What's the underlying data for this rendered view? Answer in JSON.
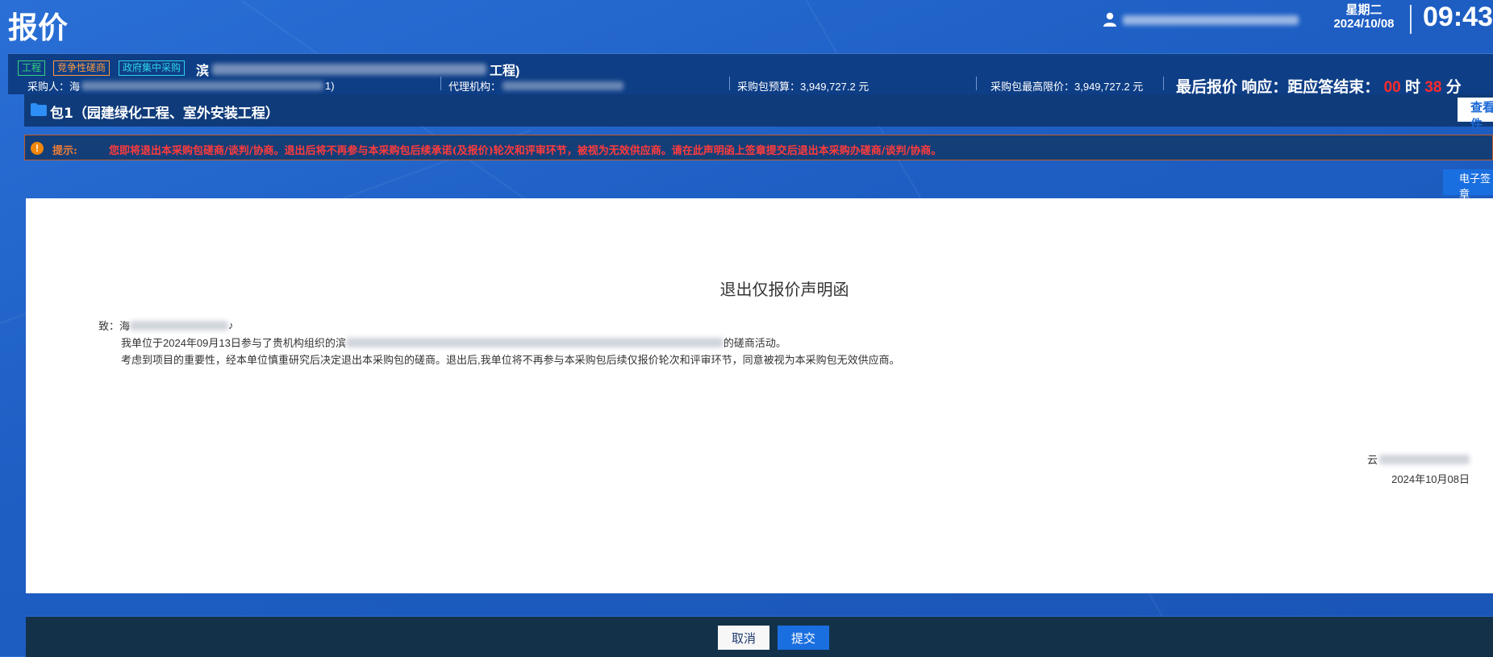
{
  "header": {
    "title": "报价",
    "weekday": "星期二",
    "date": "2024/10/08",
    "time": "09:43"
  },
  "project": {
    "tags": {
      "engineering": "工程",
      "competitive": "竞争性磋商",
      "gov_central": "政府集中采购"
    },
    "name_prefix": "滨",
    "name_suffix": "工程)",
    "purchaser_label": "采购人：海",
    "purchaser_suffix": "1)",
    "agency_label": "代理机构：",
    "budget_label": "采购包预算：3,949,727.2 元",
    "max_price_label": "采购包最高限价：3,949,727.2 元",
    "deadline": {
      "prefix": "最后报价 响应：距应答结束：",
      "hours": "00",
      "hours_unit": "时",
      "minutes": "38",
      "minutes_unit": "分"
    }
  },
  "package": {
    "title": "包1（园建绿化工程、室外安装工程）",
    "view_attachment_label": "查看附件"
  },
  "alert": {
    "label": "提示:",
    "text": "您即将退出本采购包磋商/谈判/协商。退出后将不再参与本采购包后续承诺(及报价)轮次和评审环节，被视为无效供应商。请在此声明函上签章提交后退出本采购办磋商/谈判/协商。"
  },
  "esign_label": "电子签章",
  "document": {
    "title": "退出仅报价声明函",
    "to_prefix": "致：海",
    "line1_prefix": "我单位于2024年09月13日参与了贵机构组织的滨",
    "line1_suffix": "的磋商活动。",
    "line2": "考虑到项目的重要性，经本单位慎重研究后决定退出本采购包的磋商。退出后,我单位将不再参与本采购包后续仅报价轮次和评审环节，同意被视为本采购包无效供应商。",
    "sign_prefix": "云",
    "sign_date": "2024年10月08日"
  },
  "footer": {
    "cancel_label": "取消",
    "submit_label": "提交"
  }
}
